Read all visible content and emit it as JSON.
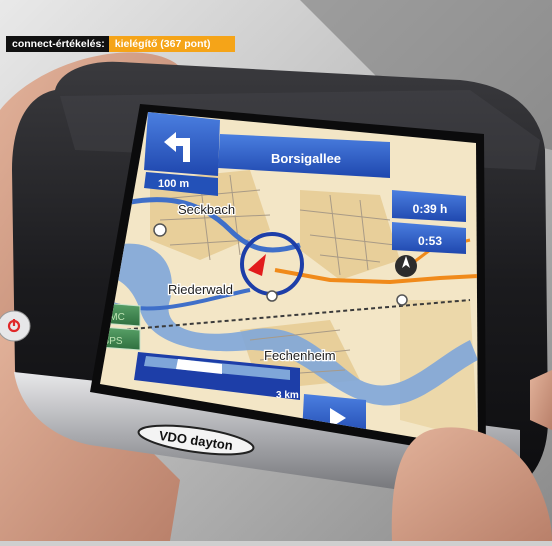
{
  "rating": {
    "label": "connect-értékelés:",
    "value": "kielégítő (367 pont)"
  },
  "nav": {
    "street": "Borsigallee",
    "turn_distance": "100 m",
    "time_remaining": "0:39 h",
    "arrival_time": "0:53",
    "scale": "3 km",
    "tmc_label": "TMC",
    "gps_label": "GPS",
    "turn_icon": "turn-left-arrow-icon",
    "next_icon": "play-arrow-icon",
    "compass_icon": "compass-icon"
  },
  "map": {
    "places": [
      "Seckbach",
      "Riederwald",
      "Fechenheim"
    ]
  },
  "device": {
    "brand": "VDO dayton",
    "power_icon": "power-icon"
  },
  "colors": {
    "accent": "#f5a418",
    "ui_blue": "#2a5bc4",
    "route": "#f08a1a",
    "device_body": "#1a1a1c"
  }
}
